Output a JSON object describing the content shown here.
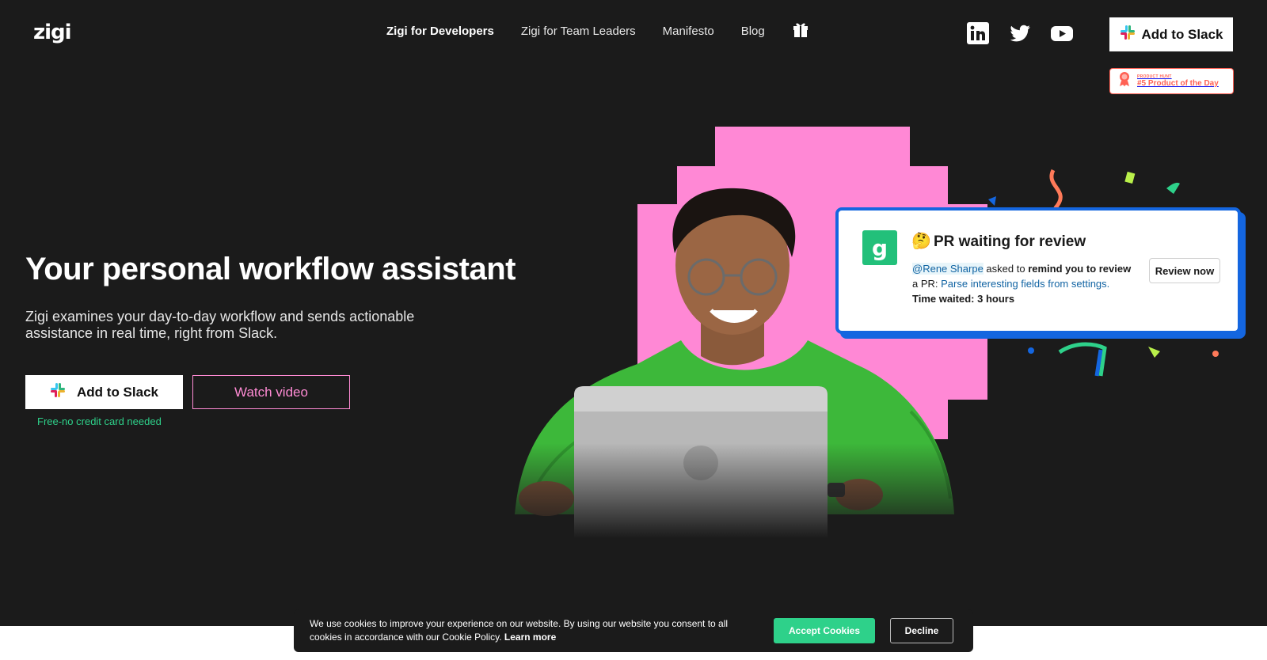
{
  "header": {
    "logo": "zigi",
    "nav": [
      {
        "label": "Zigi for Developers",
        "active": true
      },
      {
        "label": "Zigi for Team Leaders",
        "active": false
      },
      {
        "label": "Manifesto",
        "active": false
      },
      {
        "label": "Blog",
        "active": false
      }
    ],
    "gift_icon": "gift-icon",
    "social_icons": [
      "linkedin-icon",
      "twitter-icon",
      "youtube-icon"
    ],
    "slack_button_label": "Add to Slack",
    "product_hunt": {
      "small_label": "PRODUCT HUNT",
      "main_label": "#5 Product of the Day"
    }
  },
  "hero": {
    "title": "Your personal workflow assistant",
    "subtitle": "Zigi examines your day-to-day workflow and sends actionable assistance in real time, right from Slack.",
    "slack_button_label": "Add to Slack",
    "video_button_label": "Watch video",
    "free_note": "Free-no credit card needed"
  },
  "notification_card": {
    "logo_letter": "g",
    "emoji": "🤔",
    "title": "PR waiting for review",
    "mention": "@Rene Sharpe",
    "asked_to": " asked to ",
    "action": "remind you to review",
    "pr_prefix": "a PR: ",
    "pr_link": "Parse interesting fields from settings.",
    "time_waited": "Time waited: 3 hours",
    "review_button": "Review now"
  },
  "cookie_banner": {
    "text": "We use cookies to improve your experience on our website. By using our website you consent to all cookies in accordance with our Cookie Policy. ",
    "learn_more": "Learn more",
    "accept": "Accept Cookies",
    "decline": "Decline"
  },
  "colors": {
    "background": "#1b1b1b",
    "accent_green": "#2ed18a",
    "accent_pink": "#ff8bd4",
    "accent_blue": "#1466e0",
    "product_hunt": "#ff6154"
  }
}
